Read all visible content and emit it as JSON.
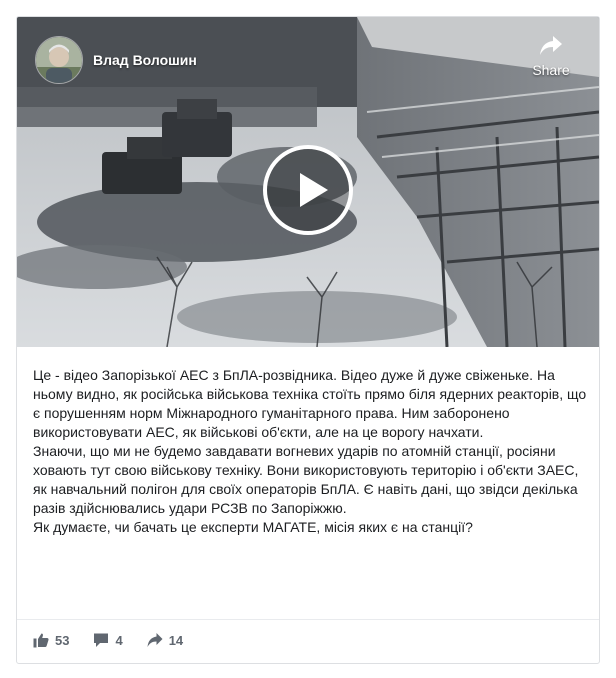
{
  "post": {
    "author": {
      "name": "Влад Волошин",
      "avatar_icon": "avatar-photo"
    },
    "video": {
      "play_icon": "play-icon",
      "share_label": "Share",
      "share_icon": "share-arrow-icon"
    },
    "text_paragraphs": [
      "Це - відео Запорізької АЕС з БпЛА-розвідника. Відео дуже й дуже свіженьке. На ньому видно, як російська військова техніка стоїть прямо біля ядерних реакторів, що є порушенням норм Міжнародного гуманітарного права. Ним заборонено використовувати АЕС, як військові об'єкти, але на це ворогу начхати.",
      "Знаючи, що ми не будемо завдавати вогневих ударів по атомній станції, росіяни ховають тут свою військову техніку. Вони використовують територію і об'єкти ЗАЕС, як навчальний полігон для своїх операторів БпЛА. Є навіть дані, що звідси декілька разів здійснювались удари РСЗВ по Запоріжжю.",
      "Як думаєте, чи бачать це експерти МАГАТЕ, місія яких є на станції?"
    ],
    "stats": {
      "likes": "53",
      "comments": "4",
      "shares": "14"
    }
  },
  "colors": {
    "text": "#1c1e21",
    "muted": "#606770",
    "border": "#dddfe2"
  }
}
